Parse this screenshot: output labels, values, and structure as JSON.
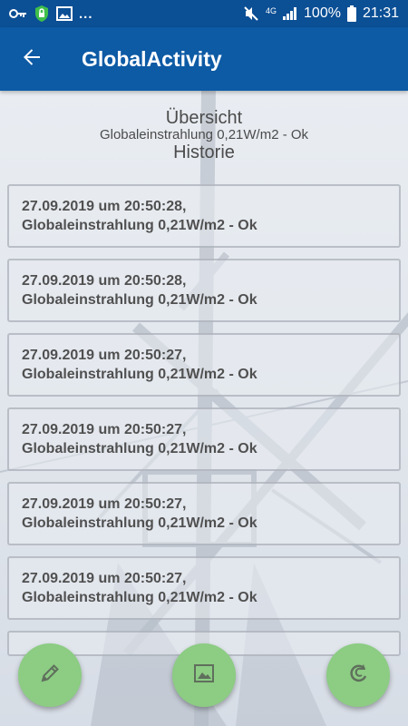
{
  "status_bar": {
    "left_overflow": "...",
    "network": "4G",
    "battery": "100%",
    "time": "21:31",
    "icons": [
      "key-icon",
      "vpn-shield-icon",
      "image-icon",
      "mute-icon",
      "signal-icon",
      "battery-icon"
    ]
  },
  "app_bar": {
    "title": "GlobalActivity",
    "back_icon": "arrow-left-icon"
  },
  "header": {
    "overview": "Übersicht",
    "summary": "Globaleinstrahlung 0,21W/m2 - Ok",
    "history": "Historie"
  },
  "history": [
    {
      "line1": "27.09.2019 um 20:50:28,",
      "line2": "Globaleinstrahlung 0,21W/m2 - Ok"
    },
    {
      "line1": "27.09.2019 um 20:50:28,",
      "line2": "Globaleinstrahlung 0,21W/m2 - Ok"
    },
    {
      "line1": "27.09.2019 um 20:50:27,",
      "line2": "Globaleinstrahlung 0,21W/m2 - Ok"
    },
    {
      "line1": "27.09.2019 um 20:50:27,",
      "line2": "Globaleinstrahlung 0,21W/m2 - Ok"
    },
    {
      "line1": "27.09.2019 um 20:50:27,",
      "line2": "Globaleinstrahlung 0,21W/m2 - Ok"
    },
    {
      "line1": "27.09.2019 um 20:50:27,",
      "line2": "Globaleinstrahlung 0,21W/m2 - Ok"
    }
  ],
  "fabs": {
    "edit_icon": "pencil-icon",
    "image_icon": "image-icon",
    "refresh_icon": "refresh-icon",
    "color": "#8ccc83"
  },
  "colors": {
    "status_bar": "#0b4f95",
    "app_bar": "#0d5aa5"
  }
}
